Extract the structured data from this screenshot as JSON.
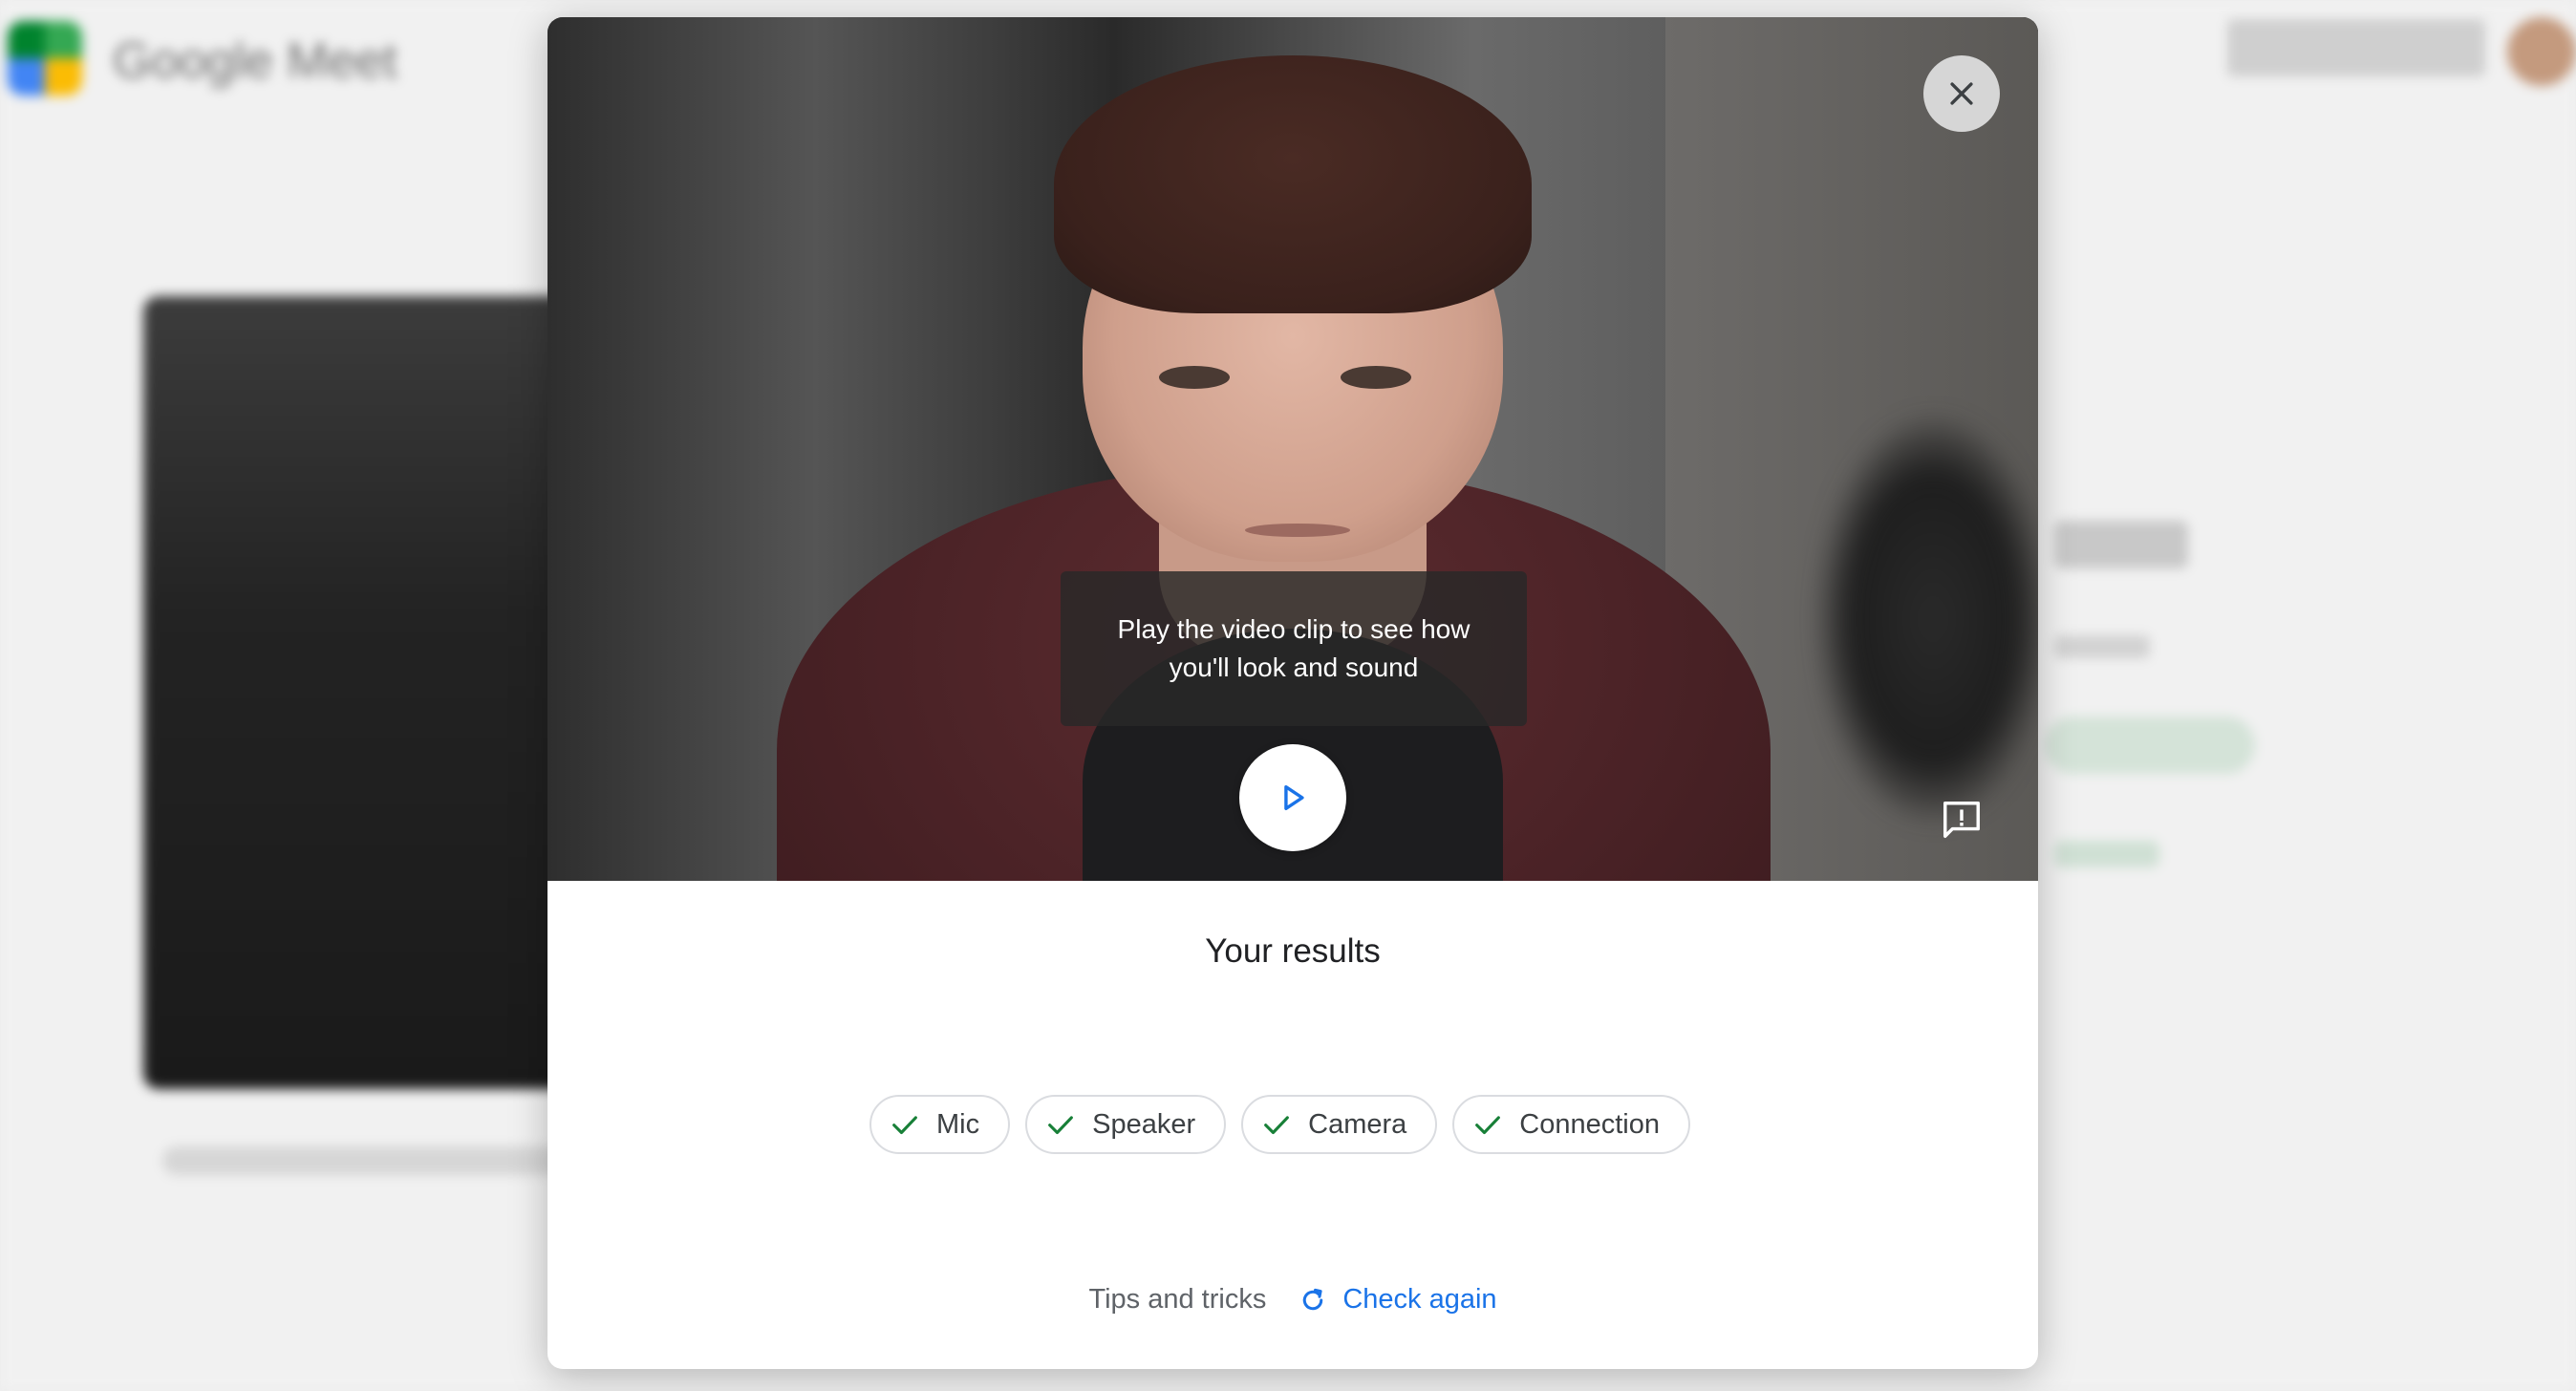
{
  "background": {
    "brand": "Google Meet"
  },
  "dialog": {
    "tooltip_line1": "Play the video clip to see how",
    "tooltip_line2": "you'll look and sound",
    "results_title": "Your results",
    "checks": [
      {
        "label": "Mic",
        "status": "passed"
      },
      {
        "label": "Speaker",
        "status": "passed"
      },
      {
        "label": "Camera",
        "status": "passed"
      },
      {
        "label": "Connection",
        "status": "passed"
      }
    ],
    "tips_label": "Tips and tricks",
    "check_again_label": "Check again"
  },
  "icons": {
    "close": "close-icon",
    "play": "play-icon",
    "feedback": "feedback-icon",
    "check": "check-icon",
    "refresh": "refresh-icon"
  },
  "colors": {
    "accent_blue": "#1a73e8",
    "success_green": "#188038",
    "chip_border": "#dadce0",
    "title_text": "#202124"
  }
}
